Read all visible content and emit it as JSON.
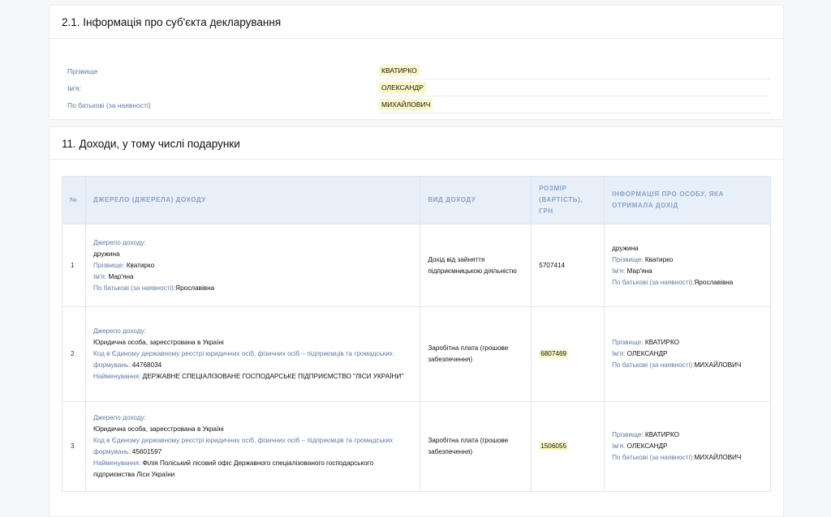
{
  "section1": {
    "title": "2.1. Інформація про суб'єкта декларування",
    "fields": [
      {
        "label": "Прізвище",
        "value": "КВАТИРКО"
      },
      {
        "label": "Ім'я:",
        "value": "ОЛЕКСАНДР"
      },
      {
        "label": "По батькові (за наявності)",
        "value": "МИХАЙЛОВИЧ"
      }
    ]
  },
  "section2": {
    "title": "11. Доходи, у тому числі подарунки",
    "table": {
      "headers": [
        "№",
        "ДЖЕРЕЛО (ДЖЕРЕЛА) ДОХОДУ",
        "ВИД ДОХОДУ",
        "РОЗМІР (ВАРТІСТЬ), ГРН",
        "ІНФОРМАЦІЯ ПРО ОСОБУ, ЯКА ОТРИМАЛА ДОХІД"
      ],
      "labels": {
        "source": "Джерело доходу:",
        "surname": "Прізвище:",
        "name": "Ім'я:",
        "patronymic": "По батькові (за наявності):",
        "code": "Код в Єдиному державному реєстрі юридичних осіб, фізичних осіб – підприємців та громадських формувань:",
        "title": "Найменування:"
      },
      "rows": [
        {
          "num": "1",
          "source_type": "дружина",
          "surname": "Кватирко",
          "name": "Мар'яна",
          "patronymic": "Ярославівна",
          "income_type": "Дохід від зайняття підприємницькою діяльністю",
          "amount": "5707414",
          "recipient_type": "дружина",
          "r_surname": "Кватирко",
          "r_name": "Мар'яна",
          "r_patronymic": "Ярославівна"
        },
        {
          "num": "2",
          "source_type": "Юридична особа, зареєстрована в Україні",
          "code": "44768034",
          "org": "ДЕРЖАВНЕ СПЕЦІАЛІЗОВАНЕ ГОСПОДАРСЬКЕ ПІДПРИЄМСТВО \"ЛІСИ УКРАЇНИ\"",
          "income_type": "Заробітна плата (грошове забезпечення)",
          "amount": "6807469",
          "r_surname": "КВАТИРКО",
          "r_name": "ОЛЕКСАНДР",
          "r_patronymic": "МИХАЙЛОВИЧ"
        },
        {
          "num": "3",
          "source_type": "Юридична особа, зареєстрована в Україні",
          "code": "45601597",
          "org": "Філія Поліський лісовий офіс Державного спеціалізованого господарського підприємства Ліси України",
          "income_type": "Заробітна плата (грошове забезпечення)",
          "amount": "1506055",
          "r_surname": "КВАТИРКО",
          "r_name": "ОЛЕКСАНДР",
          "r_patronymic": "МИХАЙЛОВИЧ"
        }
      ]
    }
  }
}
